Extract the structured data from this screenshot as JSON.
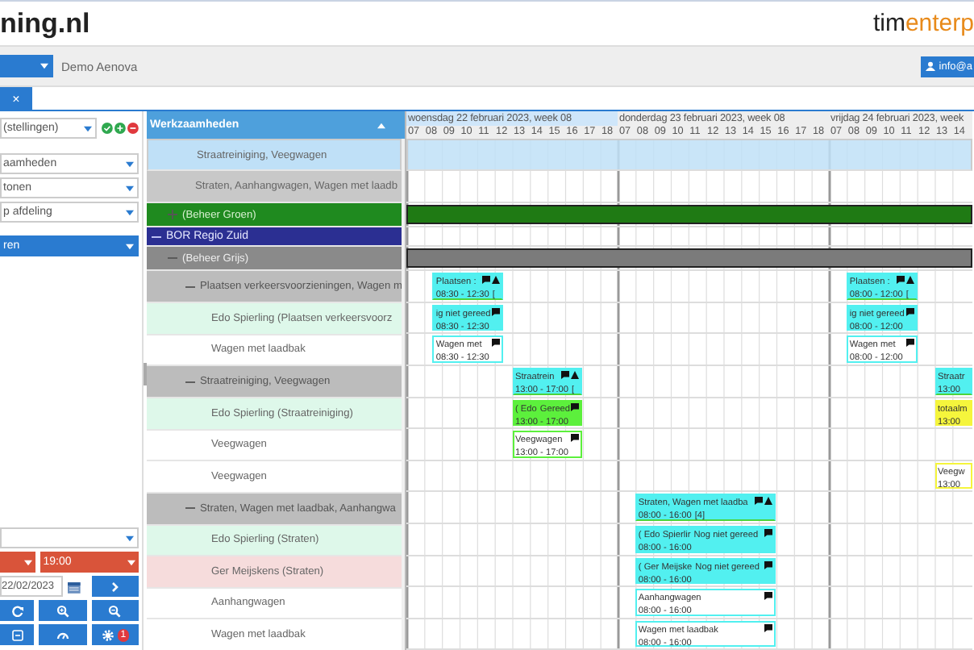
{
  "header": {
    "logo": "ning.nl",
    "brand_a": "tim",
    "brand_b": "enterp"
  },
  "toolbar": {
    "company": "Demo Aenova",
    "user": "info@a"
  },
  "tab": {
    "close": "×"
  },
  "filters": {
    "view": "(stellingen)",
    "selects": [
      "aamheden",
      "tonen",
      "p afdeling"
    ],
    "group": "ren"
  },
  "controls": {
    "end_time": "19:00",
    "date": "22/02/2023",
    "badge": "1"
  },
  "tree": {
    "title": "Werkzaamheden",
    "rows": [
      {
        "kind": "summary",
        "label": "Straatreiniging, Veegwagen",
        "selected": true
      },
      {
        "kind": "summary",
        "label": "Straten, Aanhangwagen, Wagen met laadb",
        "selected": false
      },
      {
        "kind": "group-green",
        "label": "(Beheer Groen)",
        "expanded": false
      },
      {
        "kind": "region",
        "label": "BOR Regio Zuid",
        "expanded": true,
        "children": [
          {
            "kind": "group-gray",
            "label": "(Beheer Grijs)",
            "expanded": true,
            "children": [
              {
                "kind": "subgroup",
                "label": "Plaatsen verkeersvoorzieningen, Wagen m",
                "expanded": true,
                "wednesday": {
                  "kind": "header",
                  "color": "#52f0f0",
                  "title": "Plaatsen :",
                  "time": "08:30 - 12:30",
                  "extra": "[",
                  "comment": true,
                  "alert": true
                },
                "friday": {
                  "kind": "header",
                  "color": "#52f0f0",
                  "title": "Plaatsen :",
                  "time": "08:00 - 12:00",
                  "extra": "[",
                  "comment": true,
                  "alert": true
                },
                "children": [
                  {
                    "kind": "person",
                    "label": "Edo  Spierling (Plaatsen verkeersvoorz",
                    "alert": false,
                    "wednesday": {
                      "kind": "fill",
                      "color": "#52f0f0",
                      "status": "ig niet gereed",
                      "time": "08:30 - 12:30",
                      "comment": true
                    },
                    "friday": {
                      "kind": "fill",
                      "color": "#52f0f0",
                      "status": "ig niet gereed",
                      "time": "08:00 - 12:00",
                      "comment": true
                    }
                  },
                  {
                    "kind": "resource",
                    "label": "Wagen met laadbak",
                    "wednesday": {
                      "kind": "outline",
                      "color": "#52f0f0",
                      "title": "Wagen met",
                      "time": "08:30 - 12:30",
                      "comment": true
                    },
                    "friday": {
                      "kind": "outline",
                      "color": "#52f0f0",
                      "title": "Wagen met",
                      "time": "08:00 - 12:00",
                      "comment": true
                    }
                  }
                ]
              },
              {
                "kind": "subgroup",
                "label": "Straatreiniging, Veegwagen",
                "expanded": true,
                "wednesday": {
                  "kind": "header",
                  "color": "#52f0f0",
                  "title": "Straatrein",
                  "time": "13:00 - 17:00",
                  "extra": "[",
                  "comment": true,
                  "alert": true
                },
                "friday": {
                  "kind": "header",
                  "color": "#52f0f0",
                  "title": "Straatr",
                  "time": "13:00"
                },
                "children": [
                  {
                    "kind": "person",
                    "label": "Edo  Spierling (Straatreiniging)",
                    "alert": false,
                    "wednesday": {
                      "kind": "fill",
                      "color": "#5cf03c",
                      "title": "( Edo",
                      "status": "Gereed",
                      "time": "13:00 - 17:00",
                      "comment": true
                    },
                    "friday": {
                      "kind": "fill",
                      "color": "#f5f53c",
                      "title": "totaalm",
                      "time": "13:00"
                    }
                  },
                  {
                    "kind": "resource",
                    "label": "Veegwagen",
                    "wednesday": {
                      "kind": "outline",
                      "color": "#5cf03c",
                      "title": "Veegwagen",
                      "time": "13:00 - 17:00",
                      "comment": true
                    }
                  },
                  {
                    "kind": "resource",
                    "label": "Veegwagen",
                    "friday": {
                      "kind": "outline",
                      "color": "#f5f53c",
                      "title": "Veegw",
                      "time": "13:00"
                    }
                  }
                ]
              },
              {
                "kind": "subgroup",
                "label": "Straten, Wagen met laadbak, Aanhangwa",
                "expanded": true,
                "thursday": {
                  "kind": "header",
                  "color": "#52f0f0",
                  "title": "Straten, Wagen met laadba",
                  "time": "08:00 - 16:00",
                  "extra": "[4]",
                  "comment": true,
                  "alert": true
                },
                "children": [
                  {
                    "kind": "person",
                    "label": "Edo  Spierling (Straten)",
                    "alert": false,
                    "thursday": {
                      "kind": "fill",
                      "color": "#52f0f0",
                      "title": "( Edo  Spierlir",
                      "status": "Nog niet gereed",
                      "time": "08:00 - 16:00",
                      "comment": true
                    }
                  },
                  {
                    "kind": "person",
                    "label": "Ger  Meijskens (Straten)",
                    "alert": true,
                    "thursday": {
                      "kind": "fill",
                      "color": "#52f0f0",
                      "title": "( Ger  Meijske",
                      "status": "Nog niet gereed",
                      "time": "08:00 - 16:00",
                      "comment": true
                    }
                  },
                  {
                    "kind": "resource",
                    "label": "Aanhangwagen",
                    "thursday": {
                      "kind": "outline",
                      "color": "#52f0f0",
                      "title": "Aanhangwagen",
                      "time": "08:00 - 16:00",
                      "comment": true
                    }
                  },
                  {
                    "kind": "resource",
                    "label": "Wagen met laadbak",
                    "thursday": {
                      "kind": "outline",
                      "color": "#52f0f0",
                      "title": "Wagen met laadbak",
                      "time": "08:00 - 16:00",
                      "comment": true
                    }
                  }
                ]
              }
            ]
          }
        ]
      }
    ]
  },
  "days": [
    {
      "label": "woensdag 22 februari 2023, week 08",
      "hours": [
        "07",
        "08",
        "09",
        "10",
        "11",
        "12",
        "13",
        "14",
        "15",
        "16",
        "17",
        "18"
      ]
    },
    {
      "label": "donderdag 23 februari 2023, week 08",
      "hours": [
        "07",
        "08",
        "09",
        "10",
        "11",
        "12",
        "13",
        "14",
        "15",
        "16",
        "17",
        "18"
      ]
    },
    {
      "label": "vrijdag 24 februari 2023, week",
      "hours": [
        "07",
        "08",
        "09",
        "10",
        "11",
        "12",
        "13",
        "14"
      ]
    }
  ]
}
